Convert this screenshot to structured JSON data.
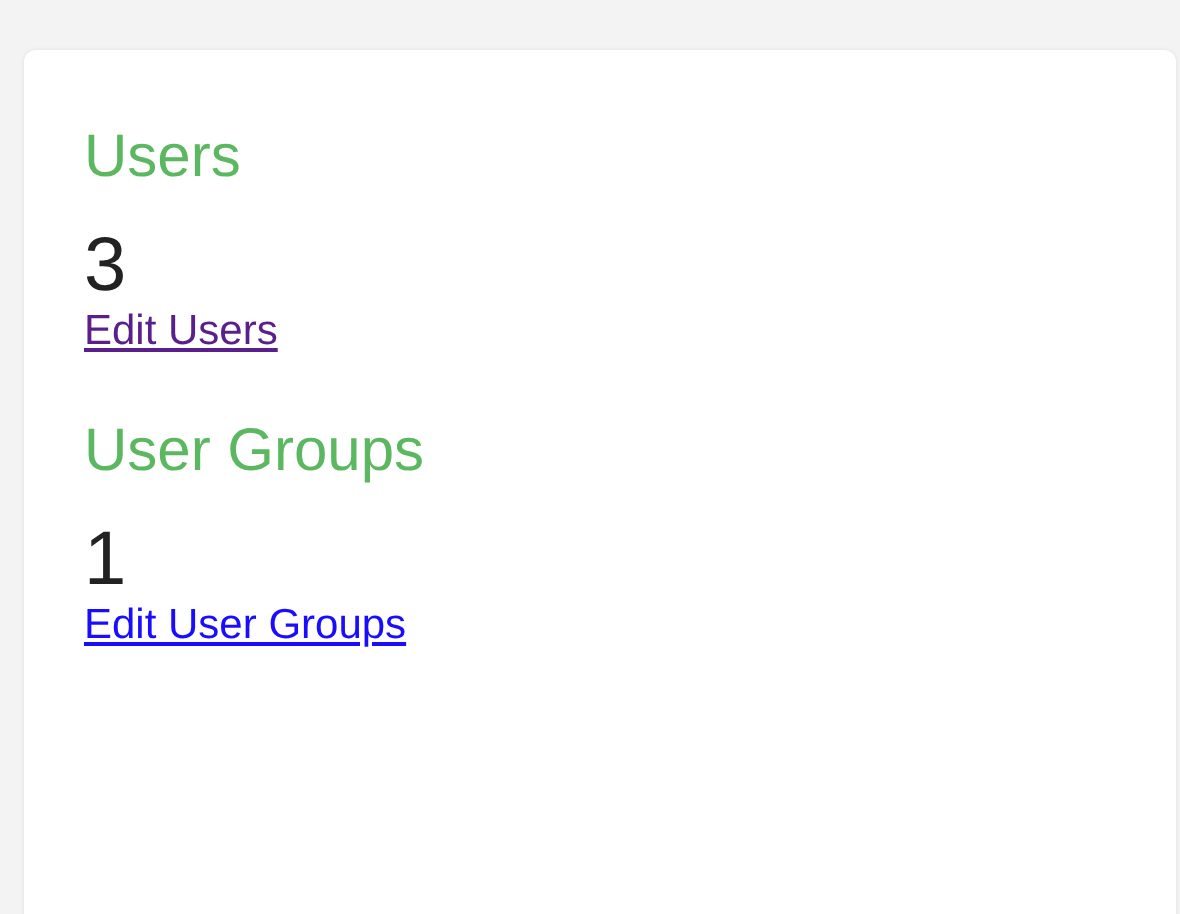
{
  "sections": [
    {
      "title": "Users",
      "count": "3",
      "link": {
        "label": "Edit Users",
        "visited": true
      }
    },
    {
      "title": "User Groups",
      "count": "1",
      "link": {
        "label": "Edit User Groups",
        "visited": false
      }
    }
  ]
}
